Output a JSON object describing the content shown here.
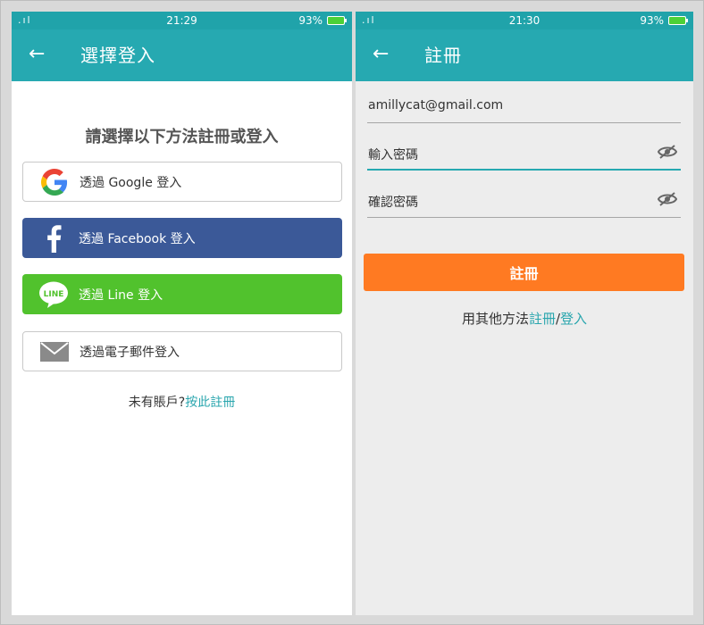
{
  "left": {
    "status": {
      "signal": ".ıl",
      "time": "21:29",
      "battery": "93%"
    },
    "appbar": {
      "back": "←",
      "title": "選擇登入"
    },
    "prompt": "請選擇以下方法註冊或登入",
    "buttons": {
      "google": "透過 Google 登入",
      "facebook": "透過 Facebook 登入",
      "line": "透過 Line 登入",
      "email": "透過電子郵件登入"
    },
    "line_logo_text": "LINE",
    "register": {
      "prefix": "未有賬戶?",
      "link": "按此註冊"
    }
  },
  "right": {
    "status": {
      "signal": ".ıl",
      "time": "21:30",
      "battery": "93%"
    },
    "appbar": {
      "back": "←",
      "title": "註冊"
    },
    "fields": {
      "email": "amillycat@gmail.com",
      "password": "輸入密碼",
      "confirm": "確認密碼"
    },
    "register_button": "註冊",
    "other": {
      "prefix": "用其他方法",
      "register": "註冊",
      "sep": "/",
      "login": "登入"
    }
  },
  "colors": {
    "appbar": "#26a9b1",
    "facebook": "#3b5998",
    "line": "#51c22d",
    "register": "#ff7a22",
    "link": "#2aa6ae"
  }
}
